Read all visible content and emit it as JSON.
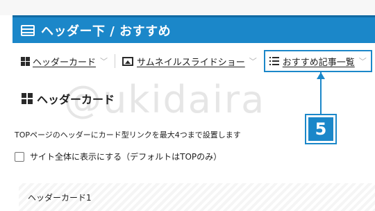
{
  "header": {
    "title": "ヘッダー下 / おすすめ",
    "icon": "layout-icon"
  },
  "tabs": [
    {
      "label": "ヘッダーカード",
      "icon": "grid-icon"
    },
    {
      "label": "サムネイルスライドショー",
      "icon": "image-icon"
    },
    {
      "label": "おすすめ記事一覧",
      "icon": "list-icon",
      "selected": true
    }
  ],
  "callout": {
    "number": "5",
    "color": "#1b87c9"
  },
  "watermark": "@ukidaira",
  "section": {
    "title": "ヘッダーカード",
    "description": "TOPページのヘッダーにカード型リンクを最大4つまで設置します",
    "checkbox_label": "サイト全体に表示にする（デフォルトはTOPのみ）",
    "checkbox_checked": false,
    "card_label": "ヘッダーカード1"
  },
  "colors": {
    "accent": "#1b87c9"
  }
}
